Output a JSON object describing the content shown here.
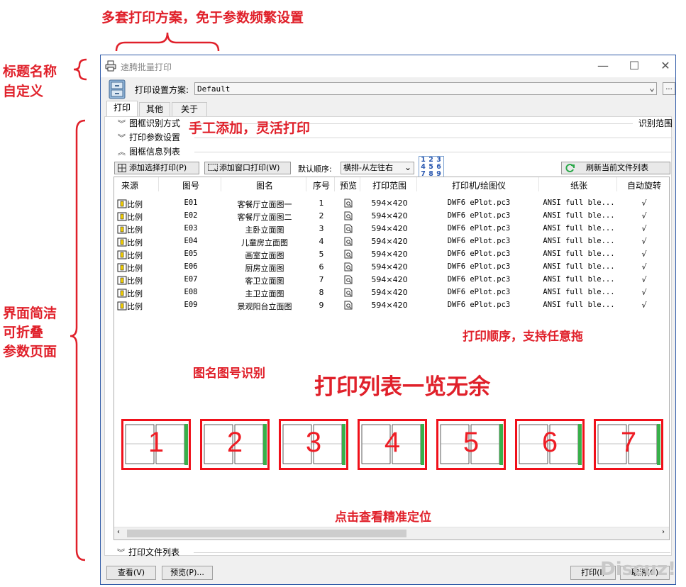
{
  "annotations": {
    "schemes": "多套打印方案，免于参数频繁设置",
    "title_custom_1": "标题名称",
    "title_custom_2": "自定义",
    "foldable_1": "界面简洁",
    "foldable_2": "可折叠",
    "foldable_3": "参数页面",
    "manual_add": "手工添加，灵活打印",
    "order": "打印顺序，支持任意拖",
    "name_recognition": "图名图号识别",
    "list_overview": "打印列表一览无余",
    "click_locate": "点击查看精准定位"
  },
  "window": {
    "title": "速腾批量打印",
    "minimize": "—",
    "maximize": "☐",
    "close": "✕"
  },
  "scheme": {
    "label": "打印设置方案:",
    "value": "Default",
    "more": "..."
  },
  "tabs": [
    "打印",
    "其他",
    "关于"
  ],
  "sections": {
    "frame_method": "图框识别方式",
    "range": "识别范围",
    "print_params": "打印参数设置",
    "frame_info": "图框信息列表",
    "file_list": "打印文件列表"
  },
  "toolbar": {
    "add_selection": "添加选择打印(P)",
    "add_window": "添加窗口打印(W)",
    "order_label": "默认顺序:",
    "order_value": "横排-从左往右",
    "order_grid": [
      "1",
      "2",
      "3",
      "4",
      "5",
      "6",
      "7",
      "8",
      "9"
    ],
    "refresh": "刷新当前文件列表"
  },
  "table": {
    "headers": [
      "来源",
      "图号",
      "图名",
      "序号",
      "预览",
      "打印范围",
      "打印机/绘图仪",
      "纸张",
      "自动旋转"
    ],
    "rows": [
      {
        "src": "比例",
        "no": "E01",
        "name": "客餐厅立面图一",
        "idx": "1",
        "range": "594×420",
        "printer": "DWF6 ePlot.pc3",
        "paper": "ANSI full ble...",
        "rot": "√"
      },
      {
        "src": "比例",
        "no": "E02",
        "name": "客餐厅立面图二",
        "idx": "2",
        "range": "594×420",
        "printer": "DWF6 ePlot.pc3",
        "paper": "ANSI full ble...",
        "rot": "√"
      },
      {
        "src": "比例",
        "no": "E03",
        "name": "主卧立面图",
        "idx": "3",
        "range": "594×420",
        "printer": "DWF6 ePlot.pc3",
        "paper": "ANSI full ble...",
        "rot": "√"
      },
      {
        "src": "比例",
        "no": "E04",
        "name": "儿童房立面图",
        "idx": "4",
        "range": "594×420",
        "printer": "DWF6 ePlot.pc3",
        "paper": "ANSI full ble...",
        "rot": "√"
      },
      {
        "src": "比例",
        "no": "E05",
        "name": "画室立面图",
        "idx": "5",
        "range": "594×420",
        "printer": "DWF6 ePlot.pc3",
        "paper": "ANSI full ble...",
        "rot": "√"
      },
      {
        "src": "比例",
        "no": "E06",
        "name": "厨房立面图",
        "idx": "6",
        "range": "594×420",
        "printer": "DWF6 ePlot.pc3",
        "paper": "ANSI full ble...",
        "rot": "√"
      },
      {
        "src": "比例",
        "no": "E07",
        "name": "客卫立面图",
        "idx": "7",
        "range": "594×420",
        "printer": "DWF6 ePlot.pc3",
        "paper": "ANSI full ble...",
        "rot": "√"
      },
      {
        "src": "比例",
        "no": "E08",
        "name": "主卫立面图",
        "idx": "8",
        "range": "594×420",
        "printer": "DWF6 ePlot.pc3",
        "paper": "ANSI full ble...",
        "rot": "√"
      },
      {
        "src": "比例",
        "no": "E09",
        "name": "景观阳台立面图",
        "idx": "9",
        "range": "594×420",
        "printer": "DWF6 ePlot.pc3",
        "paper": "ANSI full ble...",
        "rot": "√"
      }
    ]
  },
  "thumbnails": [
    "1",
    "2",
    "3",
    "4",
    "5",
    "6",
    "7"
  ],
  "buttons": {
    "view": "查看(V)",
    "preview": "预览(P)...",
    "print": "打印(I)",
    "close": "取消(C)"
  },
  "watermark": "Discuz!",
  "colors": {
    "annotation": "#e0202a",
    "window_border": "#2f5aa8",
    "thumb_border": "#f0101a"
  }
}
